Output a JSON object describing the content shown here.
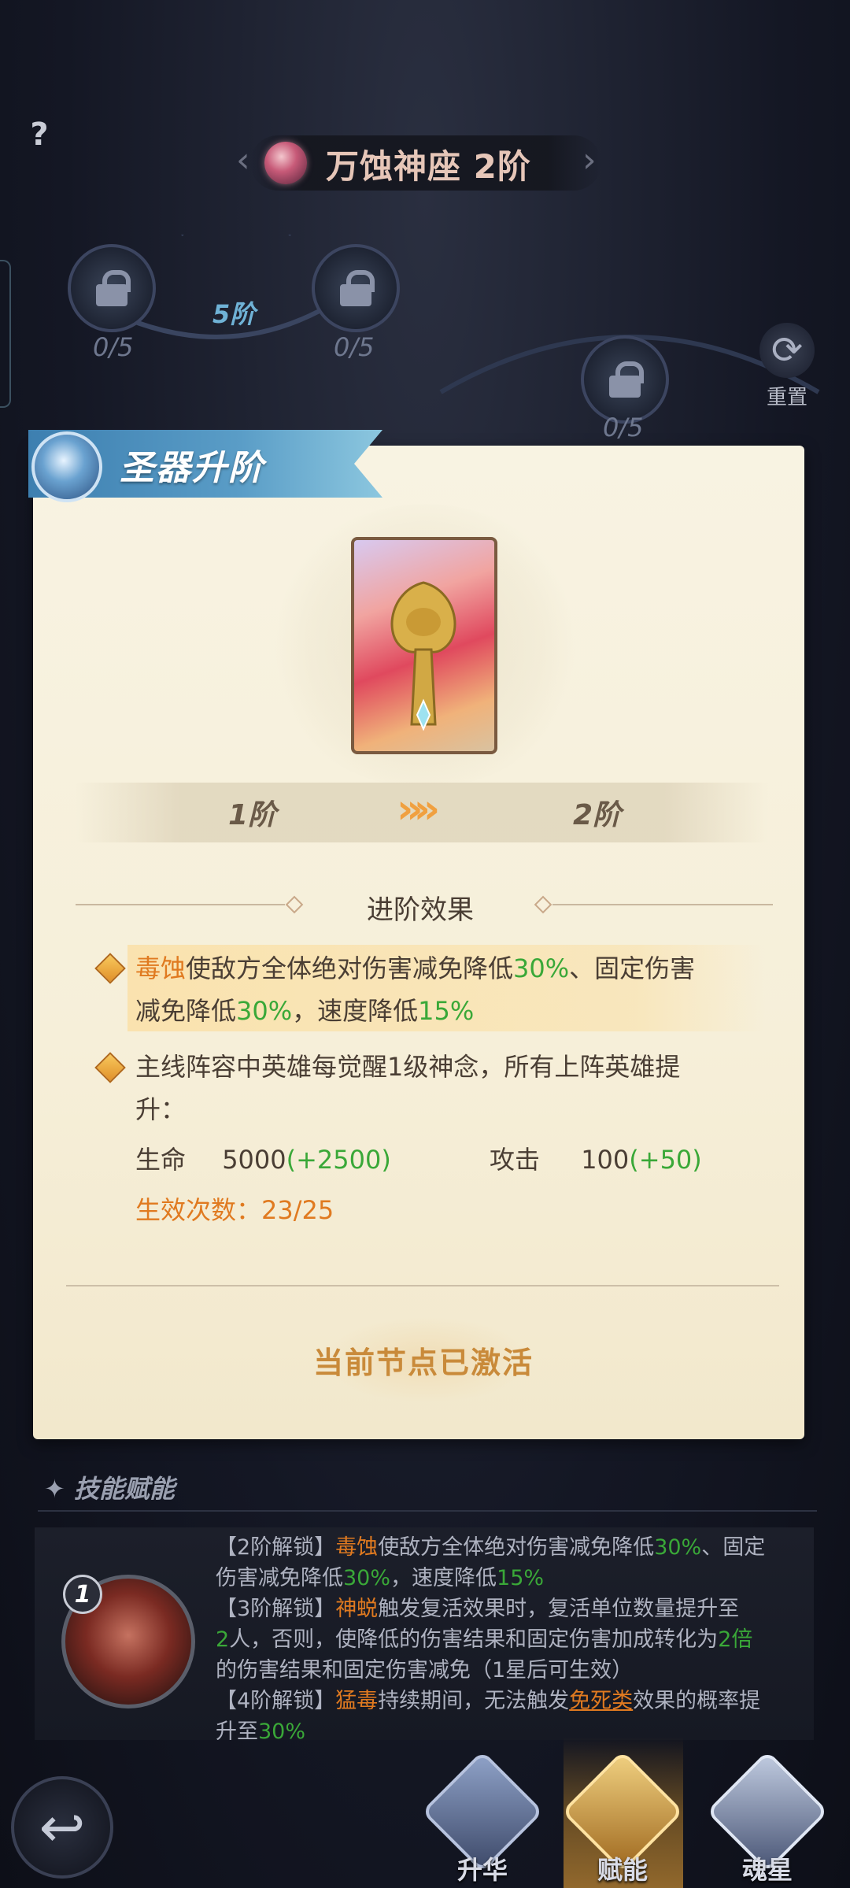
{
  "header": {
    "help": "?",
    "title": "万蚀神座 2阶"
  },
  "tree": {
    "tier_label": "5阶",
    "nodes": [
      {
        "count": "0/5"
      },
      {
        "count": "0/5"
      },
      {
        "count": "0/5"
      }
    ],
    "reset_label": "重置"
  },
  "card": {
    "ribbon_title": "圣器升阶",
    "tier_from": "1阶",
    "tier_to": "2阶",
    "section_title": "进阶效果",
    "effect1": {
      "keyword": "毒蚀",
      "text_a": "使敌方全体绝对伤害减免降低",
      "val1": "30%",
      "text_b": "、固定伤害",
      "text_c": "减免降低",
      "val2": "30%",
      "text_d": "，速度降低",
      "val3": "15%"
    },
    "effect2": {
      "line1": "主线阵容中英雄每觉醒1级神念，所有上阵英雄提",
      "line2": "升："
    },
    "stats": {
      "hp_label": "生命",
      "hp_value": "5000",
      "hp_bonus": "(+2500)",
      "atk_label": "攻击",
      "atk_value": "100",
      "atk_bonus": "(+50)"
    },
    "count_label": "生效次数：",
    "count_value": "23/25",
    "activated": "当前节点已激活"
  },
  "skill": {
    "header": "技能赋能",
    "level": "1",
    "lines": {
      "l1a": "【2阶解锁】",
      "l1k": "毒蚀",
      "l1b": "使敌方全体绝对伤害减免降低",
      "l1v": "30%",
      "l1c": "、固定",
      "l2a": "伤害减免降低",
      "l2v": "30%",
      "l2b": "，速度降低",
      "l2v2": "15%",
      "l3a": "【3阶解锁】",
      "l3k": "神蜕",
      "l3b": "触发复活效果时，复活单位数量提升至",
      "l4v": "2",
      "l4a": "人，否则，使降低的伤害结果和固定伤害加成转化为",
      "l4v2": "2倍",
      "l5": "的伤害结果和固定伤害减免（1星后可生效）",
      "l6a": "【4阶解锁】",
      "l6k": "猛毒",
      "l6b": "持续期间，无法触发",
      "l6u": "免死类",
      "l6c": "效果的概率提",
      "l7a": "升至",
      "l7v": "30%"
    }
  },
  "nav": {
    "items": [
      {
        "label": "升华"
      },
      {
        "label": "赋能"
      },
      {
        "label": "魂星"
      }
    ]
  },
  "colors": {
    "accent_orange": "#e07a20",
    "accent_green": "#3aa838",
    "ribbon_blue": "#3d7fb0"
  }
}
